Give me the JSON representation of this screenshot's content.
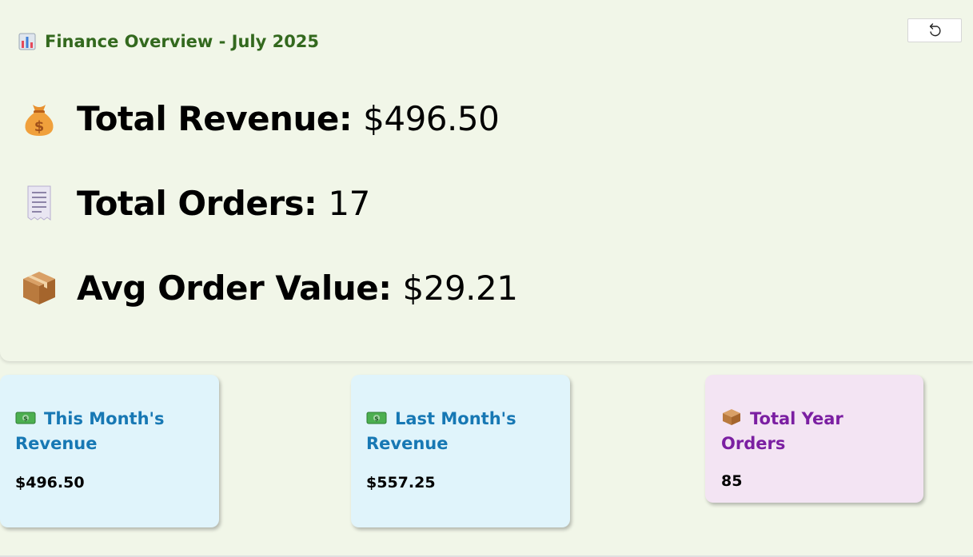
{
  "header": {
    "title": "Finance Overview - July 2025",
    "title_icon": "bar-chart-icon",
    "reset_icon": "undo-icon"
  },
  "metrics": [
    {
      "icon": "money-bag-icon",
      "label": "Total Revenue:",
      "value": "$496.50"
    },
    {
      "icon": "receipt-icon",
      "label": "Total Orders:",
      "value": "17"
    },
    {
      "icon": "package-icon",
      "label": "Avg Order Value:",
      "value": "$29.21"
    }
  ],
  "cards": [
    {
      "icon": "banknote-icon",
      "title": "This Month's Revenue",
      "value": "$496.50"
    },
    {
      "icon": "banknote-icon",
      "title": "Last Month's Revenue",
      "value": "$557.25"
    },
    {
      "icon": "package-icon",
      "title": "Total Year Orders",
      "value": "85"
    }
  ],
  "colors": {
    "background": "#f1f6e8",
    "title_green": "#33691e",
    "card_blue_bg": "#e0f4fb",
    "card_blue_text": "#1778b4",
    "card_purple_bg": "#f3e4f3",
    "card_purple_text": "#7b1fa2"
  }
}
